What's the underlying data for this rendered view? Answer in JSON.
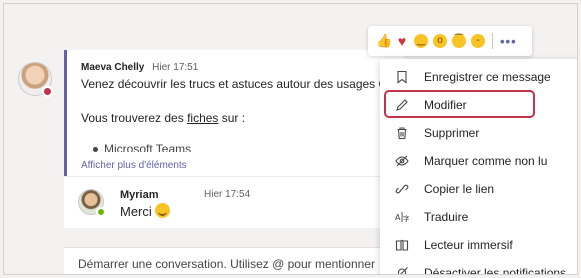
{
  "message": {
    "author": "Maeva Chelly",
    "time": "Hier 17:51",
    "line1": "Venez découvrir les trucs et astuces autour des usages C",
    "line2_prefix": "Vous trouverez des ",
    "line2_link": "fiches",
    "line2_suffix": " sur :",
    "bullet_partial": "Microsoft Teams",
    "more_link": "Afficher plus d'éléments"
  },
  "reply": {
    "author": "Myriam",
    "time": "Hier 17:54",
    "text": "Merci"
  },
  "compose": {
    "placeholder": "Démarrer une conversation. Utilisez @ pour mentionner"
  },
  "reactions": {
    "emojis": [
      "like-icon",
      "heart-icon",
      "laugh-icon",
      "surprised-icon",
      "sad-icon",
      "angry-icon"
    ],
    "more_label": "•••"
  },
  "menu": {
    "items": [
      {
        "label": "Enregistrer ce message",
        "icon": "bookmark-icon"
      },
      {
        "label": "Modifier",
        "icon": "pencil-icon"
      },
      {
        "label": "Supprimer",
        "icon": "trash-icon"
      },
      {
        "label": "Marquer comme non lu",
        "icon": "eye-off-icon"
      },
      {
        "label": "Copier le lien",
        "icon": "link-icon"
      },
      {
        "label": "Traduire",
        "icon": "translate-icon"
      },
      {
        "label": "Lecteur immersif",
        "icon": "immersive-reader-icon"
      },
      {
        "label": "Désactiver les notifications",
        "icon": "bell-off-icon"
      }
    ]
  },
  "colors": {
    "accent": "#6264a7",
    "highlight_border": "#c4314b",
    "presence_busy": "#c4314b",
    "presence_available": "#6bb700"
  }
}
